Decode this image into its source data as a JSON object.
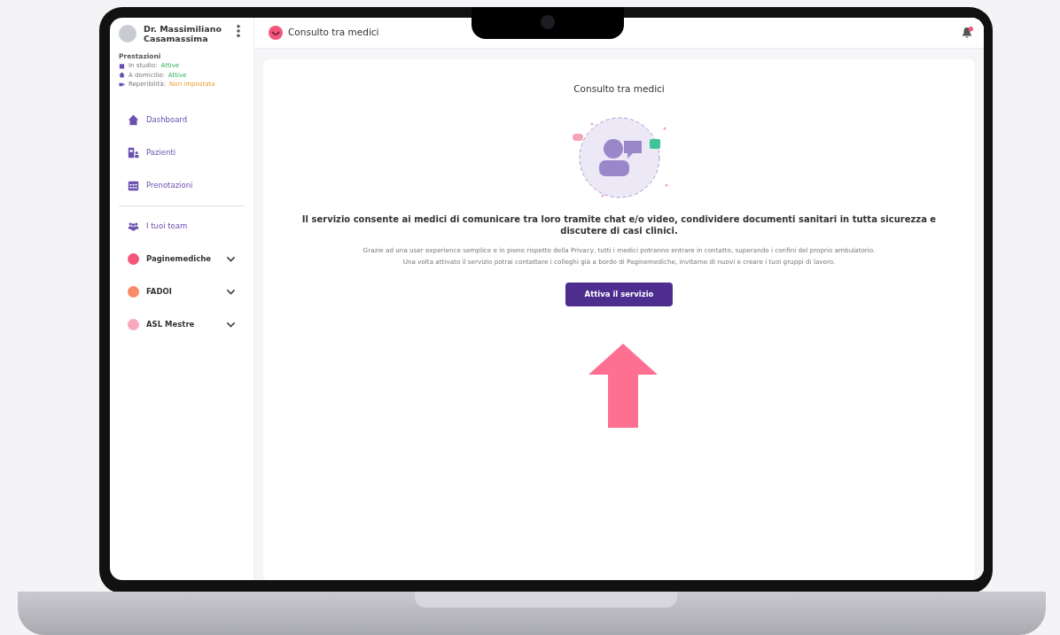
{
  "profile": {
    "name": "Dr. Massimiliano Casamassima"
  },
  "services": {
    "title": "Prestazioni",
    "items": [
      {
        "kind": "studio",
        "label": "In studio:",
        "status": "Attive",
        "active": true
      },
      {
        "kind": "home",
        "label": "A domicilio:",
        "status": "Attive",
        "active": true
      },
      {
        "kind": "video",
        "label": "Reperibilità:",
        "status": "Non impostata",
        "active": false
      }
    ]
  },
  "nav": [
    {
      "kind": "home",
      "label": "Dashboard"
    },
    {
      "kind": "patients",
      "label": "Pazienti"
    },
    {
      "kind": "calendar",
      "label": "Prenotazioni"
    }
  ],
  "team_link": {
    "label": "I tuoi team"
  },
  "teams": [
    {
      "label": "Paginemediche",
      "color": "#f2577a",
      "expanded": false
    },
    {
      "label": "FADOI",
      "color": "#fb8a68",
      "expanded": false
    },
    {
      "label": "ASL Mestre",
      "color": "#f9a8bd",
      "expanded": false
    }
  ],
  "header": {
    "title": "Consulto tra medici",
    "has_notification": true
  },
  "card": {
    "title": "Consulto tra medici",
    "headline": "Il servizio consente ai medici di comunicare tra loro tramite chat e/o video, condividere documenti sanitari in tutta sicurezza e discutere di casi clinici.",
    "body": [
      "Grazie ad una user experience semplice e in pieno rispetto della Privacy, tutti i medici potranno entrare in contatto, superando i confini del proprio ambulatorio.",
      "Una volta attivato il servizio potrai contattare i colleghi già a bordo di Paginemediche, invitarne di nuovi e creare i tuoi gruppi di lavoro."
    ],
    "button": "Attiva il servizio"
  }
}
